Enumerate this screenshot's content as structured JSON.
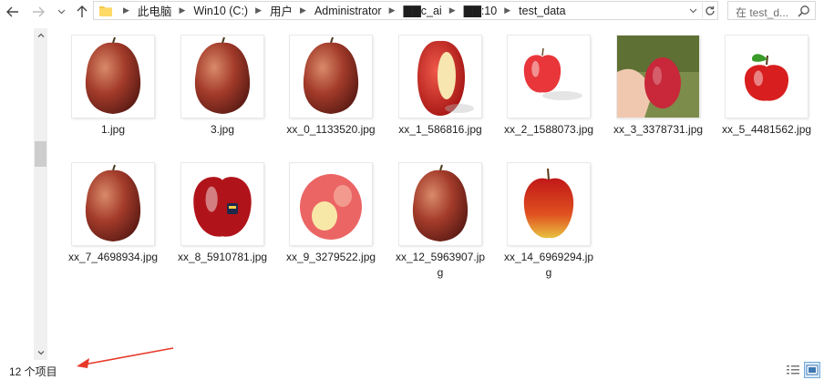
{
  "address_bar": {
    "breadcrumbs": [
      "此电脑",
      "Win10 (C:)",
      "用户",
      "Administrator",
      "▇▇c_ai",
      "▇▇:10",
      "test_data"
    ]
  },
  "search": {
    "placeholder": "在 test_d..."
  },
  "files": [
    {
      "name": "1.jpg",
      "thumb": "pear-apple"
    },
    {
      "name": "3.jpg",
      "thumb": "pear-apple"
    },
    {
      "name": "xx_0_1133520.jpg",
      "thumb": "pear-apple"
    },
    {
      "name": "xx_1_586816.jpg",
      "thumb": "bitten-apple"
    },
    {
      "name": "xx_2_1588073.jpg",
      "thumb": "small-red-apple"
    },
    {
      "name": "xx_3_3378731.jpg",
      "thumb": "hand-apple"
    },
    {
      "name": "xx_5_4481562.jpg",
      "thumb": "leaf-apple"
    },
    {
      "name": "xx_7_4698934.jpg",
      "thumb": "pear-apple"
    },
    {
      "name": "xx_8_5910781.jpg",
      "thumb": "sticker-apple"
    },
    {
      "name": "xx_9_3279522.jpg",
      "thumb": "blurry-apple"
    },
    {
      "name": "xx_12_5963907.jpg",
      "thumb": "pear-apple"
    },
    {
      "name": "xx_14_6969294.jpg",
      "thumb": "yellow-red-apple"
    }
  ],
  "status": {
    "item_count": "12 个项目"
  },
  "colors": {
    "accent": "#6fa8dc",
    "annotation_arrow": "#e8392a"
  }
}
